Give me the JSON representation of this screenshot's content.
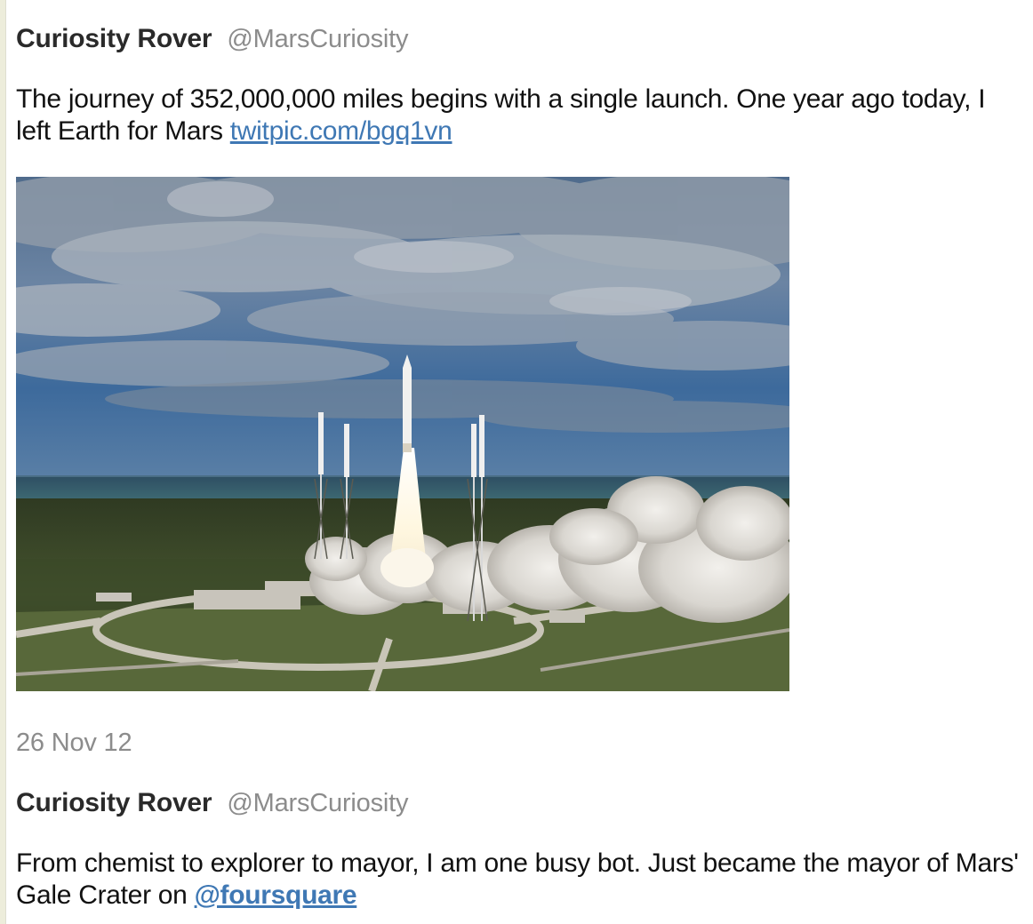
{
  "tweets": [
    {
      "author_name": "Curiosity Rover",
      "author_handle": "@MarsCuriosity",
      "text": "The journey of 352,000,000 miles begins with a single launch. One year ago today, I left Earth for Mars",
      "link_text": "twitpic.com/bgq1vn",
      "has_photo": true,
      "timestamp": "26 Nov 12"
    },
    {
      "author_name": "Curiosity Rover",
      "author_handle": "@MarsCuriosity",
      "text": "From chemist to explorer to mayor, I am one busy bot. Just became the mayor of Mars' Gale Crater on",
      "mention_text": "@foursquare"
    }
  ],
  "colors": {
    "link": "#3f78b4",
    "handle": "#8c8c8c",
    "text": "#111111"
  }
}
